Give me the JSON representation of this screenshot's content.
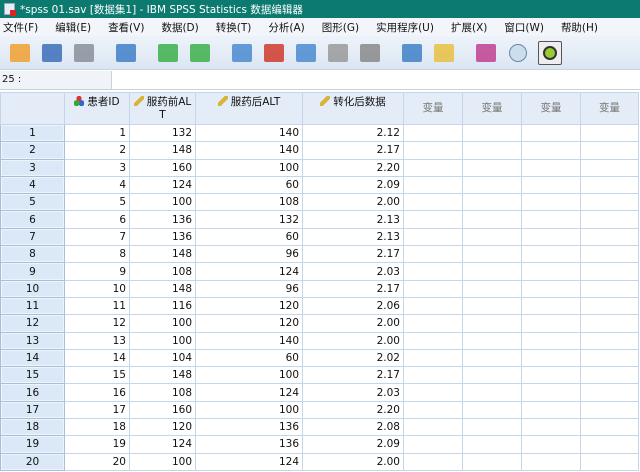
{
  "window": {
    "title": "*spss 01.sav [数据集1] - IBM SPSS Statistics 数据编辑器"
  },
  "menu": [
    "文件(F)",
    "编辑(E)",
    "查看(V)",
    "数据(D)",
    "转换(T)",
    "分析(A)",
    "图形(G)",
    "实用程序(U)",
    "扩展(X)",
    "窗口(W)",
    "帮助(H)"
  ],
  "toolbar": [
    "open-icon",
    "save-icon",
    "print-icon",
    "recall-dialog-icon",
    "undo-icon",
    "redo-icon",
    "goto-case-icon",
    "goto-variable-icon",
    "variables-icon",
    "run-descriptives-icon",
    "find-icon",
    "insert-cases-icon",
    "split-file-icon",
    "value-labels-icon",
    "use-sets-icon",
    "show-all-variables-icon"
  ],
  "cell_editor": {
    "ref": "25 :",
    "value": ""
  },
  "columns": [
    {
      "label": "患者ID",
      "icon": "nominal-icon"
    },
    {
      "label": "服药前ALT",
      "icon": "scale-icon"
    },
    {
      "label": "服药后ALT",
      "icon": "scale-icon"
    },
    {
      "label": "转化后数据",
      "icon": "scale-icon"
    },
    {
      "label": "变量"
    },
    {
      "label": "变量"
    },
    {
      "label": "变量"
    },
    {
      "label": "变量"
    }
  ],
  "rows": [
    [
      "1",
      "132",
      "140",
      "2.12"
    ],
    [
      "2",
      "148",
      "140",
      "2.17"
    ],
    [
      "3",
      "160",
      "100",
      "2.20"
    ],
    [
      "4",
      "124",
      "60",
      "2.09"
    ],
    [
      "5",
      "100",
      "108",
      "2.00"
    ],
    [
      "6",
      "136",
      "132",
      "2.13"
    ],
    [
      "7",
      "136",
      "60",
      "2.13"
    ],
    [
      "8",
      "148",
      "96",
      "2.17"
    ],
    [
      "9",
      "108",
      "124",
      "2.03"
    ],
    [
      "10",
      "148",
      "96",
      "2.17"
    ],
    [
      "11",
      "116",
      "120",
      "2.06"
    ],
    [
      "12",
      "100",
      "120",
      "2.00"
    ],
    [
      "13",
      "100",
      "140",
      "2.00"
    ],
    [
      "14",
      "104",
      "60",
      "2.02"
    ],
    [
      "15",
      "148",
      "100",
      "2.17"
    ],
    [
      "16",
      "108",
      "124",
      "2.03"
    ],
    [
      "17",
      "160",
      "100",
      "2.20"
    ],
    [
      "18",
      "120",
      "136",
      "2.08"
    ],
    [
      "19",
      "124",
      "136",
      "2.09"
    ],
    [
      "20",
      "100",
      "124",
      "2.00"
    ]
  ]
}
